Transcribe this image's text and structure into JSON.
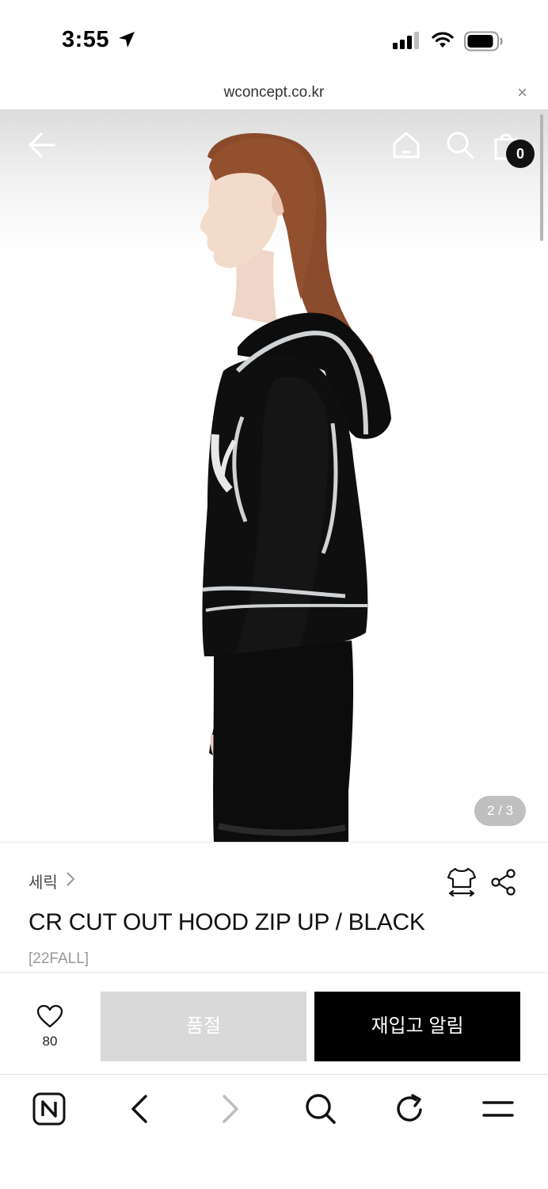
{
  "status_bar": {
    "time": "3:55",
    "icons": [
      "location-arrow-icon",
      "cellular-signal-icon",
      "wifi-icon",
      "battery-icon"
    ]
  },
  "url_bar": {
    "url": "wconcept.co.kr",
    "close_label": "×"
  },
  "top_nav": {
    "icons": [
      "back-arrow-icon",
      "home-icon",
      "search-icon",
      "shopping-bag-icon"
    ],
    "bag_count": "0"
  },
  "gallery": {
    "page_indicator": "2 / 3"
  },
  "product": {
    "brand": "세릭",
    "name": "CR CUT OUT HOOD ZIP UP / BLACK",
    "season": "[22FALL]",
    "icons": [
      "size-guide-icon",
      "share-icon"
    ]
  },
  "purchase": {
    "like_count": "80",
    "soldout_label": "품절",
    "restock_label": "재입고 알림"
  },
  "browser_toolbar": {
    "icons": [
      "naver-icon",
      "back-icon",
      "forward-icon",
      "search-icon",
      "reload-icon",
      "menu-icon"
    ]
  },
  "colors": {
    "primary_button": "#000000",
    "disabled_button": "#d9d9d9",
    "badge": "#111111"
  }
}
